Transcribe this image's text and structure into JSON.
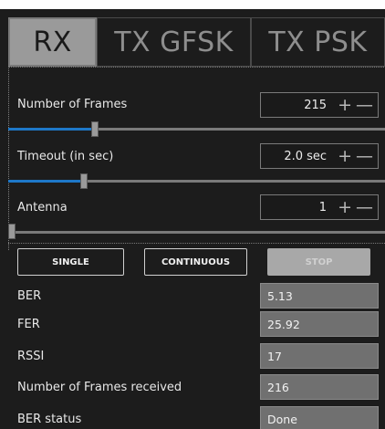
{
  "tabs": [
    {
      "label": "RX",
      "active": true
    },
    {
      "label": "TX GFSK",
      "active": false
    },
    {
      "label": "TX PSK",
      "active": false
    }
  ],
  "controls": {
    "frames": {
      "label": "Number of Frames",
      "value": "215",
      "slider_fraction": 0.23
    },
    "timeout": {
      "label": "Timeout (in sec)",
      "value": "2.0 sec",
      "slider_fraction": 0.2
    },
    "antenna": {
      "label": "Antenna",
      "value": "1",
      "slider_fraction": 0.0
    }
  },
  "stepper": {
    "plus": "+",
    "minus": "—"
  },
  "buttons": {
    "single": "SINGLE",
    "continuous": "CONTINUOUS",
    "stop": "STOP"
  },
  "results": [
    {
      "label": "BER",
      "value": "5.13"
    },
    {
      "label": "FER",
      "value": "25.92"
    },
    {
      "label": "RSSI",
      "value": "17"
    },
    {
      "label": "Number of Frames received",
      "value": "216"
    },
    {
      "label": "BER status",
      "value": "Done"
    }
  ],
  "colors": {
    "background": "#1c1c1c",
    "slider_accent": "#1e78c8",
    "field_bg": "#707070"
  }
}
